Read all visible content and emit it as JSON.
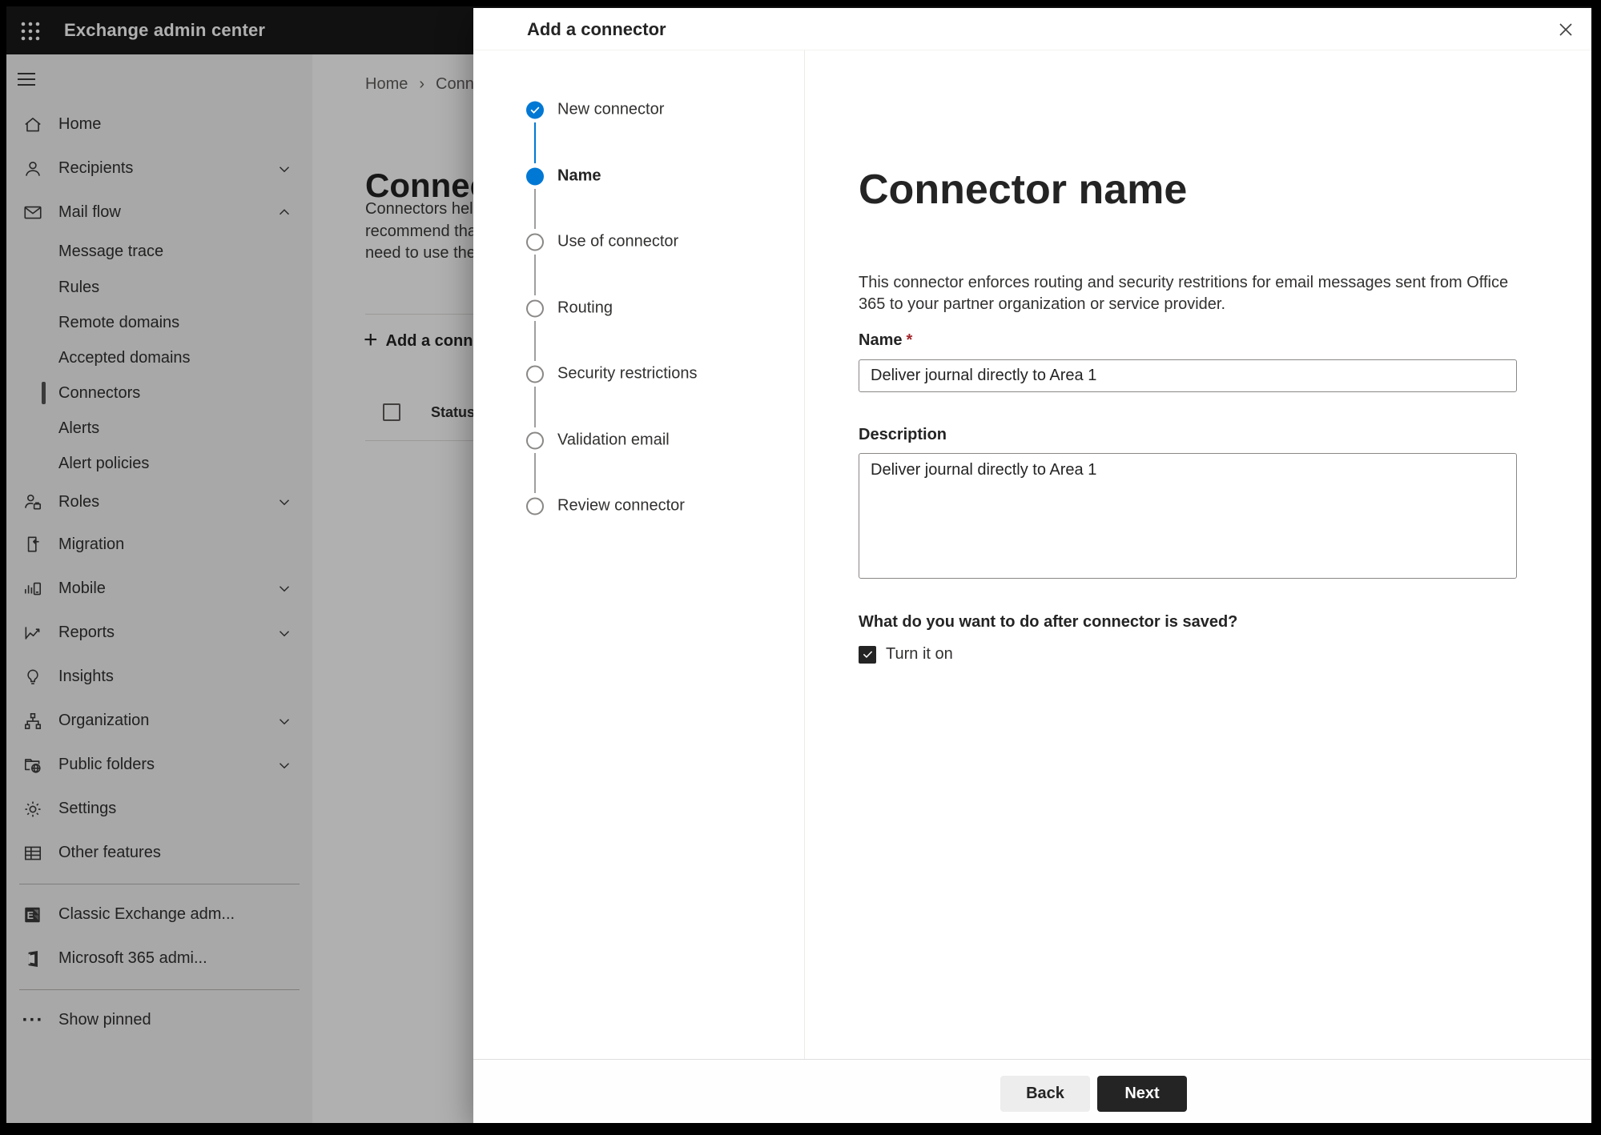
{
  "topbar": {
    "title": "Exchange admin center"
  },
  "breadcrumb": {
    "home": "Home",
    "separator": "›",
    "current": "Conne"
  },
  "background_page": {
    "heading_fragment": "Connect",
    "paragraph_lines": [
      "Connectors help",
      "recommend that",
      "need to use ther"
    ],
    "add_button_label": "Add a conn",
    "status_header": "Status"
  },
  "sidebar": {
    "items": [
      {
        "label": "Home",
        "icon": "home-icon"
      },
      {
        "label": "Recipients",
        "icon": "person-icon",
        "chevron": "down"
      },
      {
        "label": "Mail flow",
        "icon": "mail-icon",
        "chevron": "up",
        "expanded": true
      },
      {
        "label": "Message trace",
        "sub": true
      },
      {
        "label": "Rules",
        "sub": true
      },
      {
        "label": "Remote domains",
        "sub": true
      },
      {
        "label": "Accepted domains",
        "sub": true
      },
      {
        "label": "Connectors",
        "sub": true,
        "selected": true
      },
      {
        "label": "Alerts",
        "sub": true
      },
      {
        "label": "Alert policies",
        "sub": true
      },
      {
        "label": "Roles",
        "icon": "person-badge-icon",
        "chevron": "down"
      },
      {
        "label": "Migration",
        "icon": "migration-icon"
      },
      {
        "label": "Mobile",
        "icon": "mobile-chart-icon",
        "chevron": "down"
      },
      {
        "label": "Reports",
        "icon": "line-chart-icon",
        "chevron": "down"
      },
      {
        "label": "Insights",
        "icon": "lightbulb-icon"
      },
      {
        "label": "Organization",
        "icon": "org-chart-icon",
        "chevron": "down"
      },
      {
        "label": "Public folders",
        "icon": "folder-globe-icon",
        "chevron": "down"
      },
      {
        "label": "Settings",
        "icon": "gear-icon"
      },
      {
        "label": "Other features",
        "icon": "table-grid-icon"
      },
      {
        "label": "Classic Exchange adm...",
        "icon": "exchange-logo-icon"
      },
      {
        "label": "Microsoft 365 admi...",
        "icon": "office-logo-icon"
      },
      {
        "label": "Show pinned",
        "icon": "ellipsis-icon"
      }
    ]
  },
  "modal": {
    "title": "Add a connector",
    "steps": [
      {
        "label": "New connector",
        "state": "completed"
      },
      {
        "label": "Name",
        "state": "current"
      },
      {
        "label": "Use of connector",
        "state": "upcoming"
      },
      {
        "label": "Routing",
        "state": "upcoming"
      },
      {
        "label": "Security restrictions",
        "state": "upcoming"
      },
      {
        "label": "Validation email",
        "state": "upcoming"
      },
      {
        "label": "Review connector",
        "state": "upcoming"
      }
    ],
    "content": {
      "heading": "Connector name",
      "description": "This connector enforces routing and security restritions for email messages sent from Office 365 to your partner organization or service provider.",
      "name_label": "Name",
      "required_mark": "*",
      "name_value": "Deliver journal directly to Area 1",
      "description_label": "Description",
      "description_value": "Deliver journal directly to Area 1",
      "after_save_question": "What do you want to do after connector is saved?",
      "turn_on_label": "Turn it on",
      "turn_on_checked": true
    },
    "footer": {
      "back_label": "Back",
      "next_label": "Next"
    }
  },
  "icons": {
    "waffle-icon": "3x3 dot grid",
    "hamburger-icon": "three horizontal lines",
    "close-icon": "✕",
    "checkmark-icon": "✓",
    "breadcrumb-separator": "›",
    "plus-icon": "+",
    "ellipsis-icon": "···"
  },
  "colors": {
    "topbar_bg": "#191919",
    "accent_blue": "#0078d4",
    "primary_button_bg": "#242424",
    "secondary_button_bg": "#ededed",
    "required_red": "#a4262c",
    "overlay": "rgba(0,0,0,0.31)",
    "sidebar_bg": "#f4f4f4"
  }
}
